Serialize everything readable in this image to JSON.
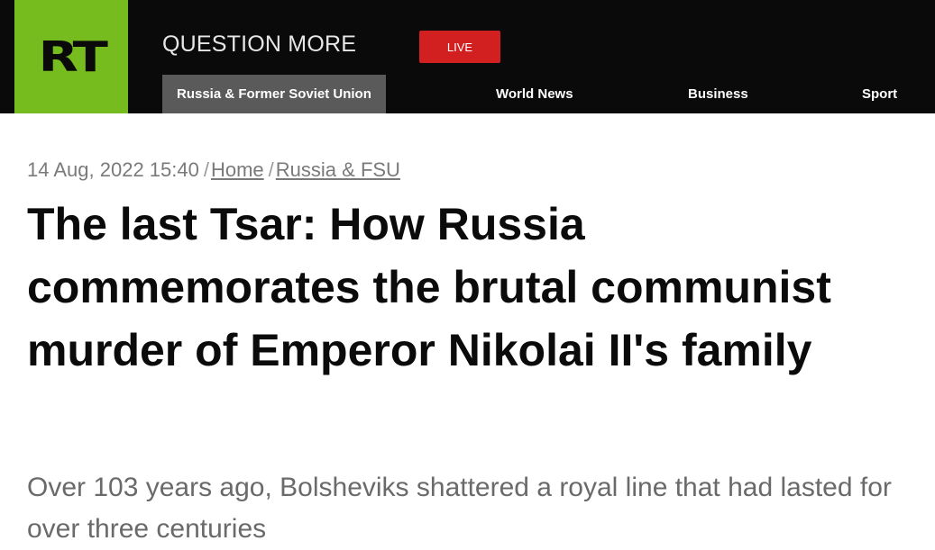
{
  "header": {
    "logo_text": "RT",
    "tagline": "QUESTION MORE",
    "live_label": "LIVE",
    "brand_green": "#77bc1f",
    "live_red": "#d21f1f"
  },
  "nav": {
    "items": [
      {
        "label": "Russia & Former Soviet Union"
      },
      {
        "label": "World News"
      },
      {
        "label": "Business"
      },
      {
        "label": "Sport"
      }
    ]
  },
  "article": {
    "date": "14 Aug, 2022 15:40",
    "breadcrumbs": [
      {
        "label": "Home"
      },
      {
        "label": "Russia & FSU"
      }
    ],
    "separator": "/",
    "title": "The last Tsar: How Russia commemorates the brutal communist murder of Emperor Nikolai II's family",
    "summary": "Over 103 years ago, Bolsheviks shattered a royal line that had lasted for over three centuries"
  }
}
